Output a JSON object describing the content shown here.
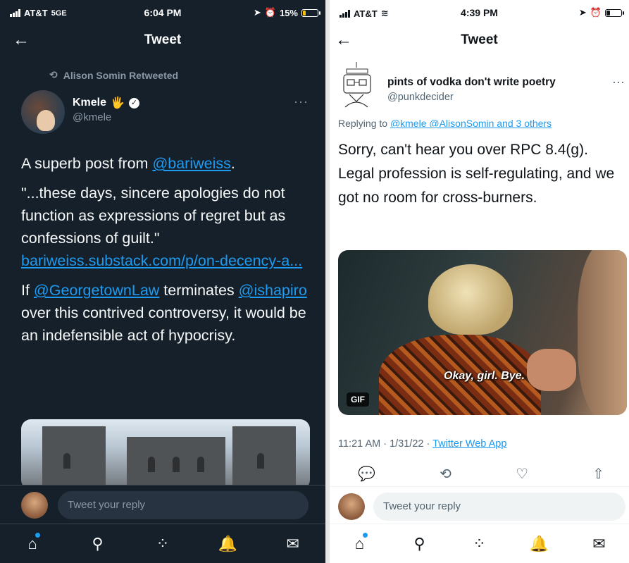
{
  "left": {
    "status": {
      "carrier": "AT&T",
      "network": "5GE",
      "time": "6:04 PM",
      "battery": "15%"
    },
    "header": {
      "back": "←",
      "title": "Tweet"
    },
    "retweet_label": "Alison Somin Retweeted",
    "author": {
      "name": "Kmele",
      "emoji": "🖐",
      "verified": "✓",
      "handle": "@kmele"
    },
    "more": "···",
    "tweet": {
      "p1_prefix": "A superb post from ",
      "p1_mention": "@bariweiss",
      "p1_suffix": ".",
      "p2_text": "\"...these days, sincere apologies do not function as expressions of regret but as confessions of guilt.\"",
      "p2_link": "bariweiss.substack.com/p/on-decency-a...",
      "p3_prefix": "If ",
      "p3_mention1": "@GeorgetownLaw",
      "p3_mid": " terminates ",
      "p3_mention2": "@ishapiro",
      "p3_suffix": " over this contrived controversy, it would be an indefensible act of hypocrisy."
    },
    "reply_placeholder": "Tweet your reply",
    "accent": "#1d9bf0",
    "background": "#15202b"
  },
  "right": {
    "status": {
      "carrier": "AT&T",
      "time": "4:39 PM"
    },
    "header": {
      "back": "←",
      "title": "Tweet"
    },
    "author": {
      "name": "pints of vodka don't write poetry",
      "handle": "@punkdecider"
    },
    "more": "···",
    "replying_prefix": "Replying to ",
    "replying_to": "@kmele @AlisonSomin and 3 others",
    "tweet_text": "Sorry, can't hear you over RPC 8.4(g).  Legal profession is self-regulating, and we got no room for cross-burners.",
    "gif_caption": "Okay, girl. Bye.",
    "gif_badge": "GIF",
    "timestamp": "11:21 AM · 1/31/22 · ",
    "source_app": "Twitter Web App",
    "reply_placeholder": "Tweet your reply",
    "accent": "#1d9bf0"
  },
  "icons": {
    "home": "home-icon",
    "search": "search-icon",
    "spaces": "spaces-icon",
    "notifications": "bell-icon",
    "messages": "mail-icon",
    "reply": "reply-icon",
    "retweet": "retweet-icon",
    "like": "heart-icon",
    "share": "share-icon"
  }
}
